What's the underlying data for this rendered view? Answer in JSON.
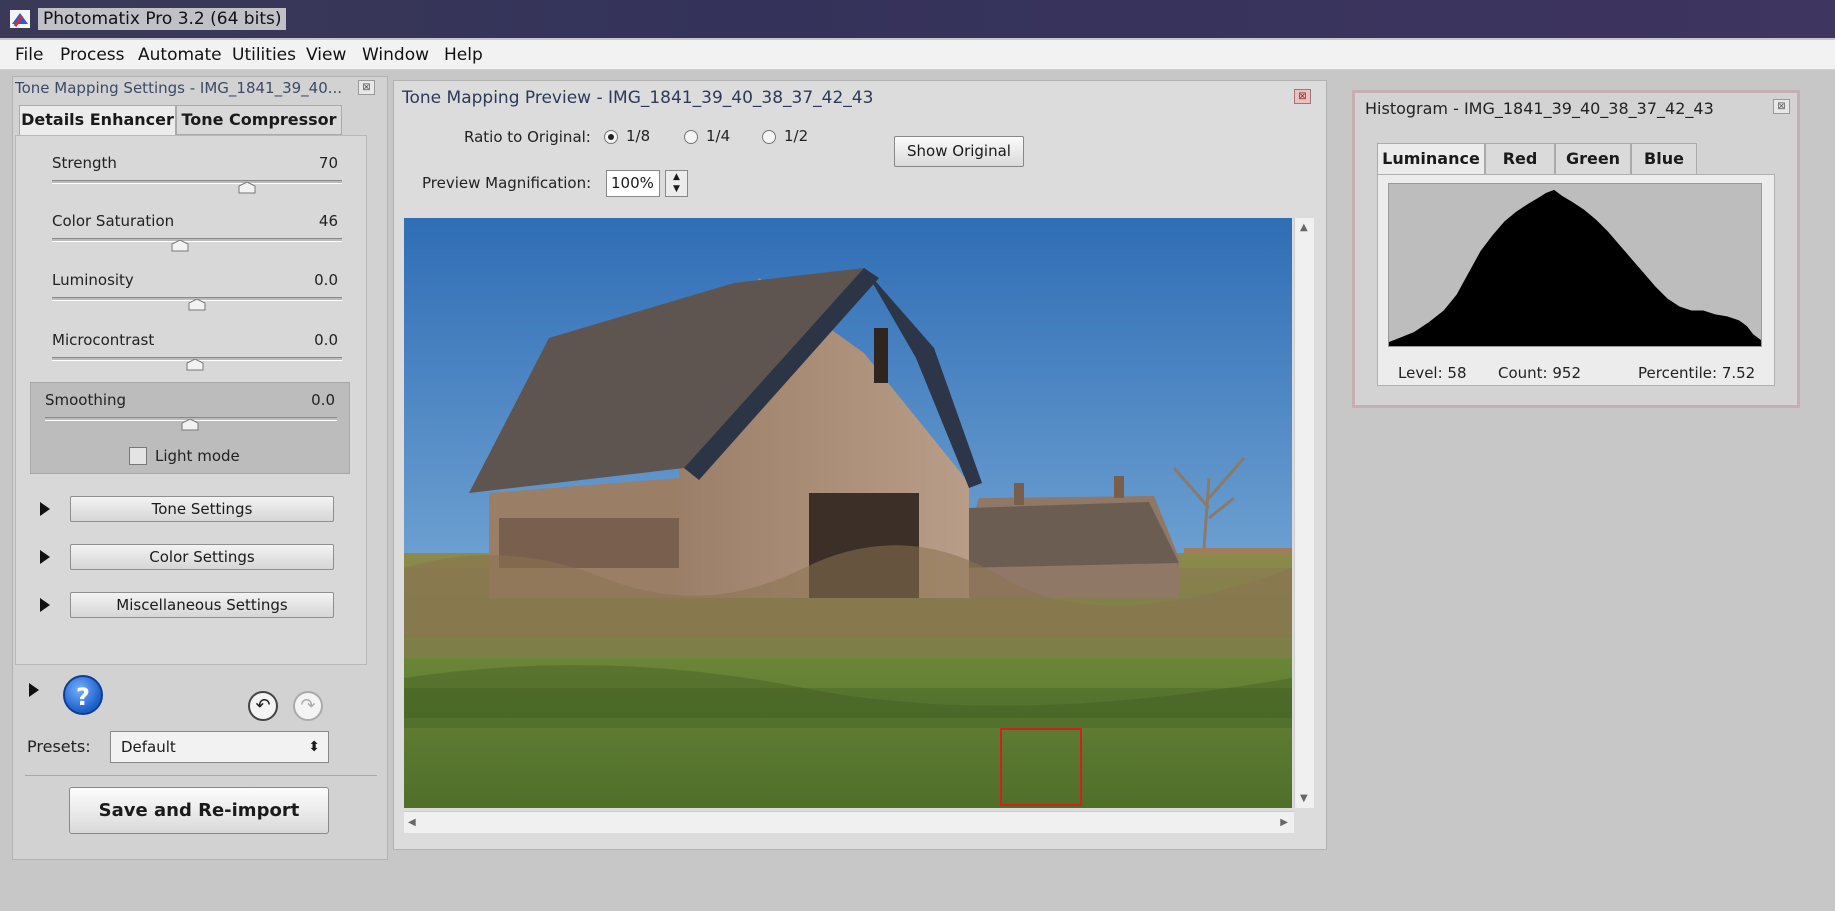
{
  "window": {
    "title": "Photomatix Pro 3.2 (64 bits)"
  },
  "menu": [
    "File",
    "Process",
    "Automate",
    "Utilities",
    "View",
    "Window",
    "Help"
  ],
  "settings_panel": {
    "title": "Tone Mapping Settings - IMG_1841_39_40...",
    "tabs": [
      {
        "label": "Details Enhancer",
        "active": true
      },
      {
        "label": "Tone Compressor",
        "active": false
      }
    ],
    "sliders": [
      {
        "label": "Strength",
        "value": "70"
      },
      {
        "label": "Color Saturation",
        "value": "46"
      },
      {
        "label": "Luminosity",
        "value": "0.0"
      },
      {
        "label": "Microcontrast",
        "value": "0.0"
      },
      {
        "label": "Smoothing",
        "value": "0.0"
      }
    ],
    "light_mode_label": "Light mode",
    "sections": [
      "Tone Settings",
      "Color Settings",
      "Miscellaneous Settings"
    ],
    "help_glyph": "?",
    "presets_label": "Presets:",
    "preset_value": "Default",
    "save_label": "Save and Re-import"
  },
  "preview_panel": {
    "title": "Tone Mapping Preview - IMG_1841_39_40_38_37_42_43",
    "ratio_label": "Ratio to Original:",
    "ratio_options": [
      "1/8",
      "1/4",
      "1/2"
    ],
    "ratio_selected": "1/8",
    "show_original_label": "Show Original",
    "magnification_label": "Preview Magnification:",
    "magnification_value": "100%"
  },
  "histogram_panel": {
    "title": "Histogram - IMG_1841_39_40_38_37_42_43",
    "tabs": [
      "Luminance",
      "Red",
      "Green",
      "Blue"
    ],
    "active_tab": "Luminance",
    "level": "Level: 58",
    "count": "Count: 952",
    "percentile": "Percentile: 7.52"
  },
  "colors": {
    "titlebar": "#34325a",
    "help_blue": "#1b5dc9",
    "selection_red": "#d02020"
  },
  "icons": [
    "app-icon",
    "close-icon",
    "expand-arrow-icon",
    "help-icon",
    "undo-icon",
    "redo-icon",
    "dropdown-arrows-icon"
  ]
}
